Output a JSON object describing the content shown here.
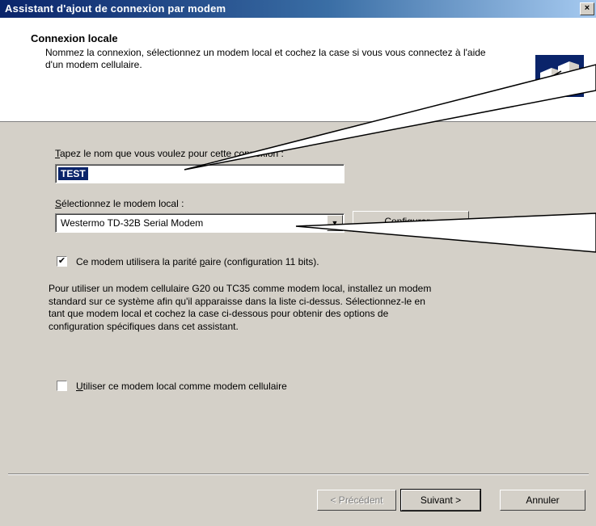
{
  "window": {
    "title": "Assistant d'ajout de connexion par modem",
    "close_glyph": "×"
  },
  "header": {
    "title": "Connexion locale",
    "subtitle": "Nommez la connexion, sélectionnez un modem local et cochez la case si vous vous connectez à l'aide d'un modem cellulaire.",
    "icon": "network-connection-icon"
  },
  "form": {
    "name_label_access": "T",
    "name_label_rest": "apez le nom que vous voulez pour cette connexion :",
    "name_value": "TEST",
    "modem_label_access": "S",
    "modem_label_rest": "électionnez le modem local :",
    "modem_value": "Westermo TD-32B Serial Modem",
    "configure_label": "Configurer...",
    "parity_checked": true,
    "parity_label_prefix": "Ce modem utilisera la parité ",
    "parity_label_access": "p",
    "parity_label_suffix": "aire (configuration 11 bits).",
    "info_text": "Pour utiliser un modem cellulaire G20 ou TC35 comme modem local, installez un modem standard sur ce système afin qu'il apparaisse dans la liste ci-dessus. Sélectionnez-le en tant que modem local et cochez la case ci-dessous pour obtenir des options de configuration spécifiques dans cet assistant.",
    "cellular_checked": false,
    "cellular_label_access": "U",
    "cellular_label_rest": "tiliser ce modem local comme modem cellulaire"
  },
  "buttons": {
    "previous": "< Précédent",
    "next": "Suivant >",
    "cancel": "Annuler"
  },
  "colors": {
    "titlebar_start": "#0a246a",
    "titlebar_end": "#a6caf0",
    "dialog_bg": "#d4d0c8",
    "selection": "#0a246a"
  }
}
